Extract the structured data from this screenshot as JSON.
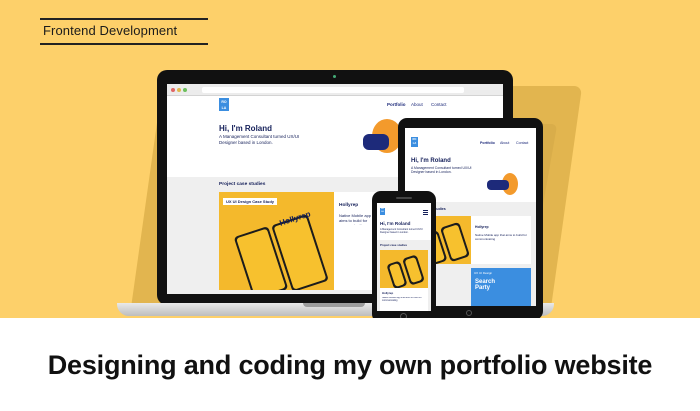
{
  "category": "Frontend Development",
  "headline": "Designing and coding my own portfolio website",
  "site": {
    "logo": "RO LA",
    "nav": [
      "Portfolio",
      "About",
      "Contact"
    ],
    "greeting": "Hi, I'm Roland",
    "intro": "A Management Consultant turned UX/UI Designer based in London.",
    "section_title": "Project case studies",
    "project_badge": "UX UI Design Case Study",
    "project_brand": "Hollyrep",
    "project_name": "Hollyrep",
    "project_desc": "Native Mobile app that aims to build for communicating",
    "project2_badge": "UX UI Design",
    "project2_name": "Search Party"
  },
  "colors": {
    "hero_bg": "#fdd06a",
    "accent": "#f4b92c",
    "navy": "#15205a",
    "blue": "#3b8ee0"
  },
  "icons": [
    "browser-dots",
    "laptop-camera",
    "phone-speaker",
    "home-button"
  ]
}
